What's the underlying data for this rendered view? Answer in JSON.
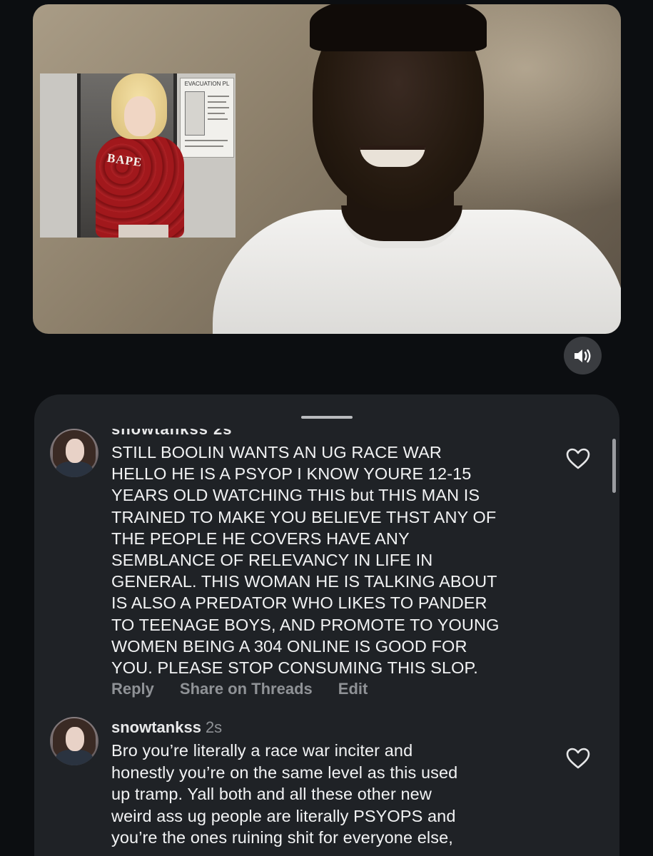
{
  "video": {
    "inset_poster_title": "EVACUATION PL",
    "hoodie_text": "BAPE",
    "volume_icon": "speaker-volume-icon"
  },
  "comments": {
    "handle_icon": "drag-handle",
    "items": [
      {
        "username_cut": "snowtankss 2s",
        "text": "STILL BOOLIN WANTS AN UG RACE WAR\nHELLO HE IS A PSYOP I KNOW YOURE 12-15\nYEARS OLD WATCHING THIS but THIS MAN IS\nTRAINED TO MAKE YOU BELIEVE THST ANY OF\nTHE PEOPLE HE COVERS HAVE ANY\nSEMBLANCE OF RELEVANCY IN LIFE IN\nGENERAL. THIS WOMAN HE IS TALKING ABOUT\nIS ALSO A PREDATOR WHO LIKES TO PANDER\nTO TEENAGE BOYS, AND PROMOTE TO YOUNG\nWOMEN BEING A 304 ONLINE IS GOOD FOR\nYOU. PLEASE STOP CONSUMING THIS SLOP.",
        "actions": {
          "reply": "Reply",
          "share": "Share on Threads",
          "edit": "Edit"
        }
      },
      {
        "username": "snowtankss",
        "time": "2s",
        "text": "Bro you’re literally a race war inciter and\nhonestly you’re on the same level as this used\nup tramp. Yall both and all these other new\nweird ass ug people are literally PSYOPS and\nyou’re the ones ruining shit for everyone else,"
      }
    ]
  },
  "colors": {
    "background": "#0c0e11",
    "sheet": "#1f2226",
    "text": "#f2f3f4",
    "muted": "#8f9296"
  }
}
